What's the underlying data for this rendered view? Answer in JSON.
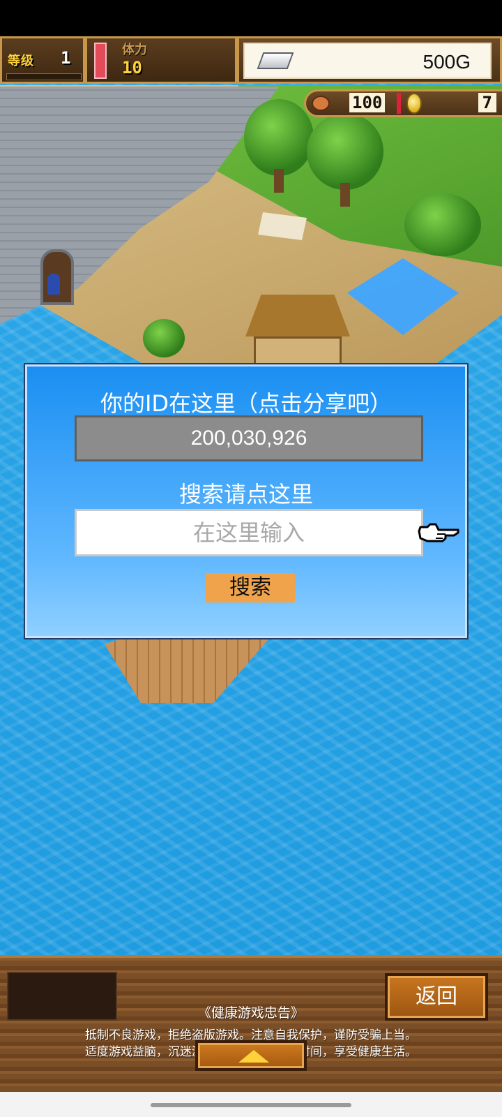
{
  "hud": {
    "level_label": "等级",
    "level_value": "1",
    "stamina_label": "体力",
    "stamina_value": "10",
    "gold_value": "500G",
    "food_value": "100",
    "coin_value": "7",
    "stamina_fill": 1.0
  },
  "dialog": {
    "id_title": "你的ID在这里（点击分享吧）",
    "id_value": "200,030,926",
    "search_title": "搜索请点这里",
    "search_placeholder": "在这里输入",
    "search_value": "",
    "search_button": "搜索"
  },
  "bottom": {
    "back_button": "返回",
    "notice_title": "《健康游戏忠告》",
    "notice_line1": "抵制不良游戏，拒绝盗版游戏。注意自我保护，谨防受骗上当。",
    "notice_line2": "适度游戏益脑，沉迷游戏伤身。合理安排时间，享受健康生活。"
  },
  "icons": [
    "silver-ingot-icon",
    "meat-icon",
    "coin-icon",
    "pointing-hand-icon",
    "triangle-up-icon"
  ],
  "colors": {
    "dialog_blue": "#1a8ff2",
    "search_button": "#f0a34a",
    "hud_gold": "#ffd23a",
    "stamina_red": "#e24b5a"
  }
}
